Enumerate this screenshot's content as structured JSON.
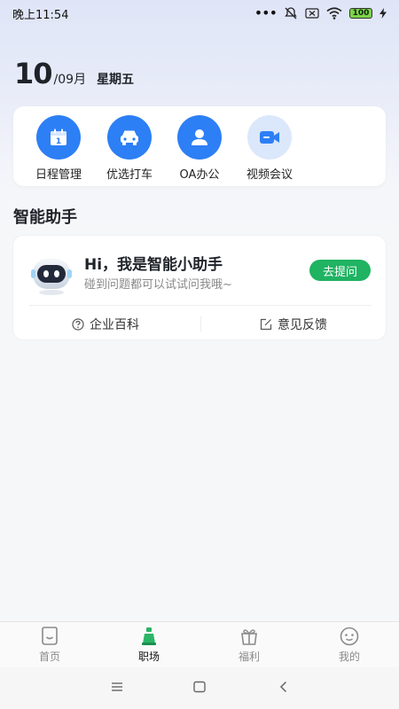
{
  "status": {
    "time": "晚上11:54",
    "battery": "100"
  },
  "date": {
    "day": "10",
    "month": "/09月",
    "weekday": "星期五"
  },
  "quick_actions": [
    {
      "label": "日程管理",
      "icon": "calendar-icon"
    },
    {
      "label": "优选打车",
      "icon": "car-icon"
    },
    {
      "label": "OA办公",
      "icon": "person-icon"
    },
    {
      "label": "视频会议",
      "icon": "video-icon"
    }
  ],
  "assistant": {
    "section_title": "智能助手",
    "title": "Hi，我是智能小助手",
    "subtitle": "碰到问题都可以试试问我哦~",
    "ask_button": "去提问",
    "link_wiki": "企业百科",
    "link_feedback": "意见反馈"
  },
  "tabs": [
    {
      "label": "首页",
      "icon": "home-icon"
    },
    {
      "label": "职场",
      "icon": "workplace-icon",
      "active": true
    },
    {
      "label": "福利",
      "icon": "gift-icon"
    },
    {
      "label": "我的",
      "icon": "profile-icon"
    }
  ],
  "colors": {
    "accent_green": "#1fb362",
    "accent_blue": "#2d7ff5"
  }
}
